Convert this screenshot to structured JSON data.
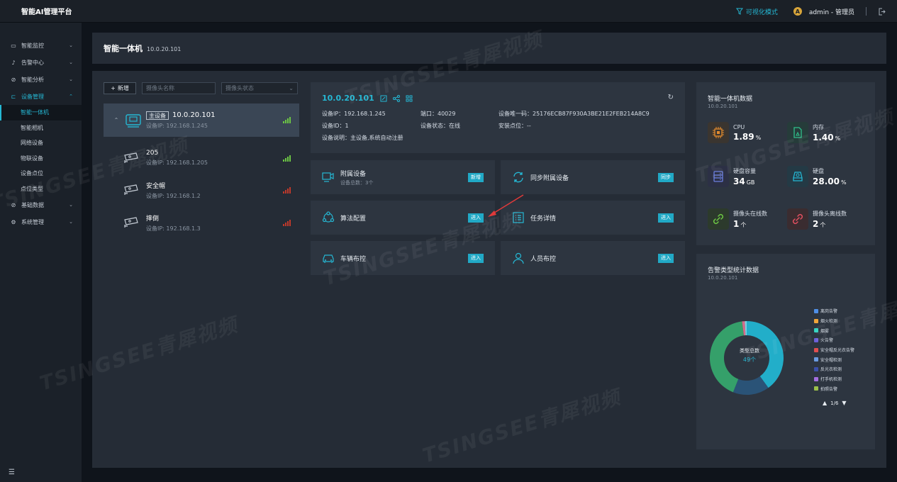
{
  "app": {
    "title": "智能AI管理平台"
  },
  "topbar": {
    "vis_mode": "可视化模式",
    "avatar_letter": "A",
    "user": "admin - 管理员"
  },
  "sidebar": {
    "items": [
      {
        "label": "智能监控",
        "icon": "monitor-icon"
      },
      {
        "label": "告警中心",
        "icon": "bell-icon"
      },
      {
        "label": "智能分析",
        "icon": "compass-icon"
      },
      {
        "label": "设备管理",
        "icon": "camera-device-icon",
        "expanded": true
      },
      {
        "label": "基础数据",
        "icon": "compass-icon"
      },
      {
        "label": "系统管理",
        "icon": "gear-icon"
      }
    ],
    "subitems": [
      "智能一体机",
      "智能相机",
      "网络设备",
      "物联设备",
      "设备点位",
      "点位类型"
    ]
  },
  "header": {
    "title": "智能一体机",
    "subtitle": "10.0.20.101"
  },
  "toolbar": {
    "add_label": "新增",
    "name_placeholder": "摄像头名称",
    "status_placeholder": "摄像头状态"
  },
  "device_tree": {
    "root": {
      "tag": "主设备",
      "name": "10.0.20.101",
      "ip": "设备IP:   192.168.1.245",
      "signal_color": "#6cc644"
    },
    "cameras": [
      {
        "name": "205",
        "ip": "设备IP:   192.168.1.205",
        "signal_color": "#6cc644"
      },
      {
        "name": "安全帽",
        "ip": "设备IP:   192.168.1.2",
        "signal_color": "#c0392b"
      },
      {
        "name": "摔倒",
        "ip": "设备IP:   192.168.1.3",
        "signal_color": "#c0392b"
      }
    ]
  },
  "info_card": {
    "ip": "10.0.20.101",
    "fields": {
      "device_ip": "设备IP：192.168.1.245",
      "port": "端口：40029",
      "uid": "设备唯一码：25176ECB87F930A3BE21E2FEB214A8C9",
      "device_id": "设备ID：1",
      "status": "设备状态：在线",
      "location": "安装点位：--",
      "description": "设备说明：主设备,系统自动注册"
    }
  },
  "func_cards": [
    {
      "title": "附属设备",
      "sub": "设备总数：3个",
      "button": "新增"
    },
    {
      "title": "同步附属设备",
      "sub": "",
      "button": "同步"
    },
    {
      "title": "算法配置",
      "sub": "",
      "button": "进入"
    },
    {
      "title": "任务详情",
      "sub": "",
      "button": "进入"
    },
    {
      "title": "车辆布控",
      "sub": "",
      "button": "进入"
    },
    {
      "title": "人员布控",
      "sub": "",
      "button": "进入"
    }
  ],
  "stats": {
    "title": "智能一体机数据",
    "subtitle": "10.0.20.101",
    "items": [
      {
        "label": "CPU",
        "value": "1.89",
        "unit": "%",
        "color": "#e08a2e"
      },
      {
        "label": "内存",
        "value": "1.40",
        "unit": "%",
        "color": "#2fbf8a"
      },
      {
        "label": "硬盘容量",
        "value": "34",
        "unit": "GB",
        "color": "#6b7fe0"
      },
      {
        "label": "硬盘",
        "value": "28.00",
        "unit": "%",
        "color": "#25b7d3"
      },
      {
        "label": "摄像头在线数",
        "value": "1",
        "unit": "个",
        "color": "#6cc644"
      },
      {
        "label": "摄像头离线数",
        "value": "2",
        "unit": "个",
        "color": "#e04f5f"
      }
    ]
  },
  "alarm": {
    "title": "告警类型统计数据",
    "subtitle": "10.0.20.101",
    "center_label": "类型总数",
    "center_value": "49个",
    "legend": [
      {
        "name": "离岗告警",
        "color": "#4f8fe6"
      },
      {
        "name": "烟火检测",
        "color": "#f0a53a"
      },
      {
        "name": "烟雾",
        "color": "#2fd3c0"
      },
      {
        "name": "火告警",
        "color": "#6b5fd8"
      },
      {
        "name": "安全帽反光衣告警",
        "color": "#e04f4f"
      },
      {
        "name": "安全帽检测",
        "color": "#6b9be0"
      },
      {
        "name": "反光衣检测",
        "color": "#3b4fa8"
      },
      {
        "name": "打手机检测",
        "color": "#a46ee0"
      },
      {
        "name": "拍照告警",
        "color": "#9bc04a"
      }
    ],
    "pager": "1/6",
    "chart_data": {
      "type": "pie",
      "segments": [
        {
          "value": 40,
          "color": "#22aec9"
        },
        {
          "value": 16,
          "color": "#2a5377"
        },
        {
          "value": 42,
          "color": "#35a06a"
        },
        {
          "value": 1.2,
          "color": "#d66a8a"
        },
        {
          "value": 0.8,
          "color": "#7bd0e0"
        }
      ]
    }
  },
  "watermark": "TSINGSEE青犀视频"
}
